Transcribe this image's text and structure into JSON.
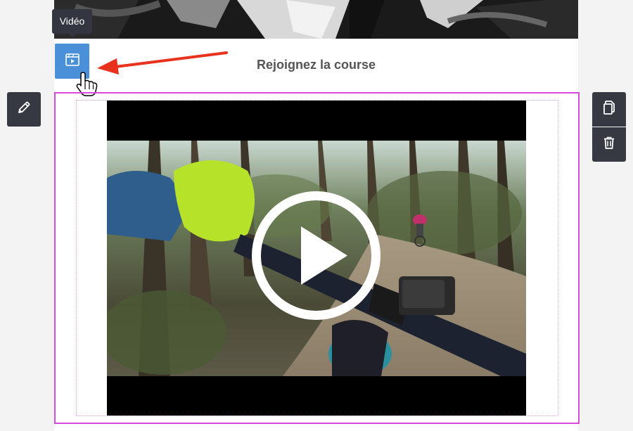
{
  "tooltip": {
    "label": "Vidéo"
  },
  "content": {
    "heading": "Rejoignez la course"
  },
  "toolbar": {
    "video_block_icon": "video-player-icon",
    "edit_icon": "pencil-icon",
    "duplicate_icon": "copy-icon",
    "delete_icon": "trash-icon"
  },
  "colors": {
    "selection_border": "#d54bde",
    "active_button": "#4a90d9",
    "toolbar_dark": "#363842",
    "annotation_arrow": "#e8321e"
  }
}
